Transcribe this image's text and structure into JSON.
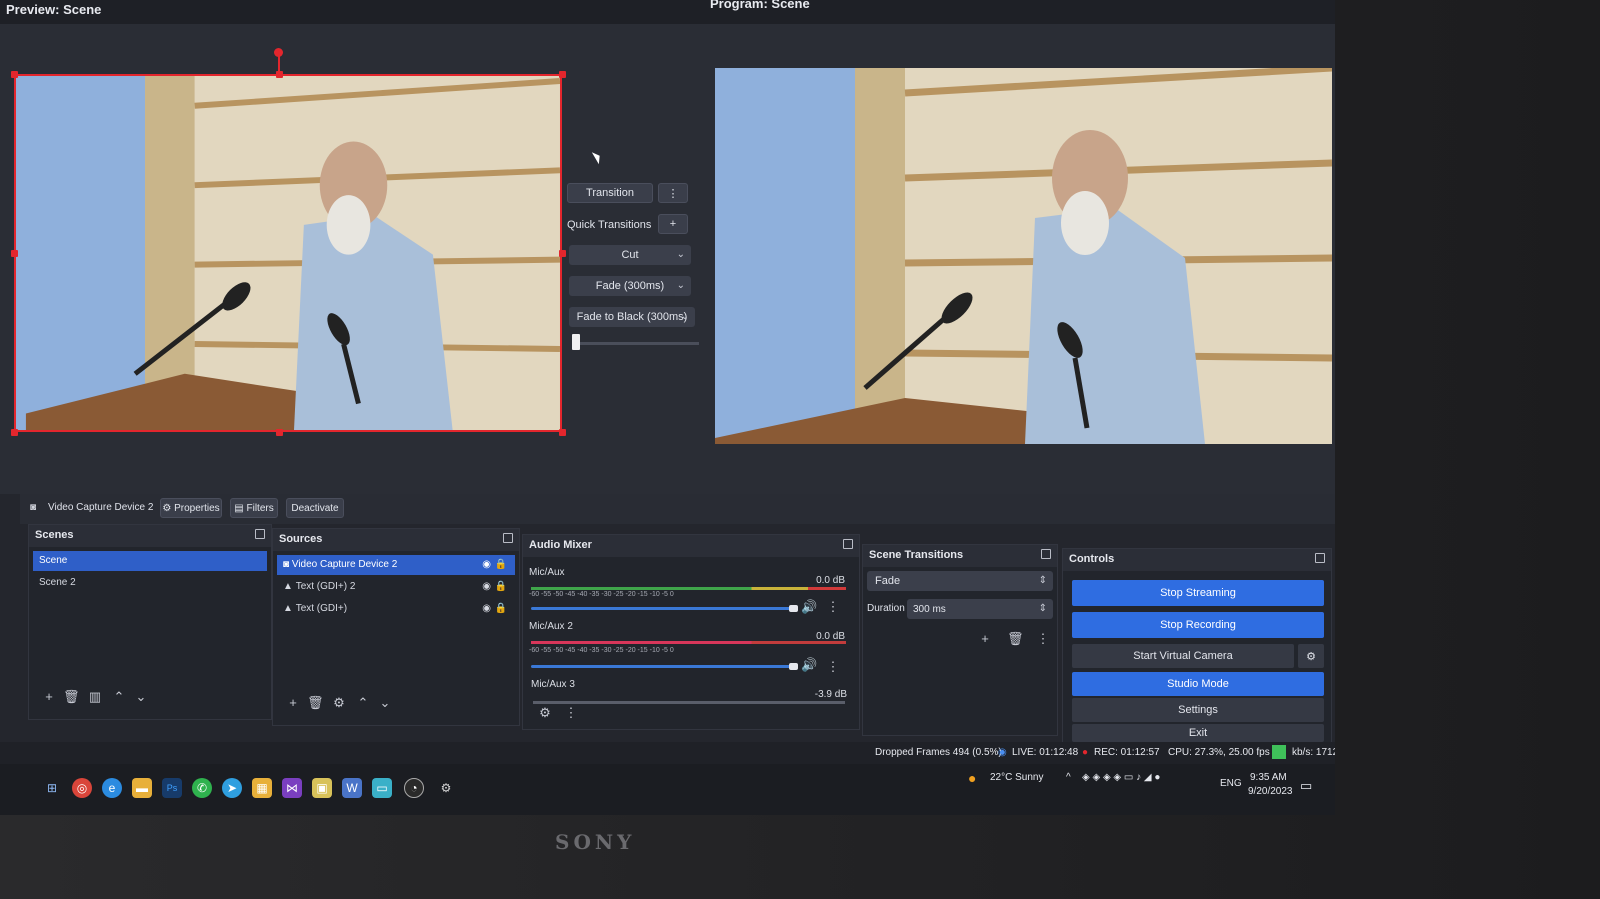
{
  "header": {
    "preview_title": "Preview: Scene",
    "program_title": "Program: Scene"
  },
  "transition_panel": {
    "transition_label": "Transition",
    "quick_transitions_label": "Quick Transitions",
    "items": [
      "Cut",
      "Fade (300ms)",
      "Fade to Black (300ms)"
    ],
    "tbar_value": 0
  },
  "source_toolbar": {
    "source_name": "Video Capture Device 2",
    "properties": "Properties",
    "filters": "Filters",
    "deactivate": "Deactivate"
  },
  "scenes": {
    "title": "Scenes",
    "items": [
      "Scene",
      "Scene 2"
    ]
  },
  "sources": {
    "title": "Sources",
    "items": [
      "Video Capture Device 2",
      "Text (GDI+) 2",
      "Text (GDI+)"
    ]
  },
  "audio_mixer": {
    "title": "Audio Mixer",
    "channels": [
      {
        "name": "Mic/Aux",
        "db": "0.0 dB",
        "level": 1.0
      },
      {
        "name": "Mic/Aux 2",
        "db": "0.0 dB",
        "level": 1.0
      },
      {
        "name": "Mic/Aux 3",
        "db": "-3.9 dB",
        "level": 0.9
      }
    ],
    "ticks": "-60 -55 -50 -45 -40 -35 -30 -25 -20 -15 -10 -5 0"
  },
  "scene_transitions": {
    "title": "Scene Transitions",
    "selected": "Fade",
    "duration_label": "Duration",
    "duration_value": "300 ms"
  },
  "controls": {
    "title": "Controls",
    "stop_streaming": "Stop Streaming",
    "stop_recording": "Stop Recording",
    "start_virtual_camera": "Start Virtual Camera",
    "studio_mode": "Studio Mode",
    "settings": "Settings",
    "exit": "Exit"
  },
  "status": {
    "dropped_frames": "Dropped Frames 494 (0.5%)",
    "live": "LIVE: 01:12:48",
    "rec": "REC: 01:12:57",
    "cpu": "CPU: 27.3%, 25.00 fps",
    "kbps": "kb/s: 1712"
  },
  "system_tray": {
    "weather": "22°C Sunny",
    "lang": "ENG",
    "time": "9:35 AM",
    "date": "9/20/2023"
  },
  "monitor": {
    "brand": "SONY"
  },
  "colors": {
    "accent": "#2f6de1",
    "selection_border": "#e3262d"
  }
}
